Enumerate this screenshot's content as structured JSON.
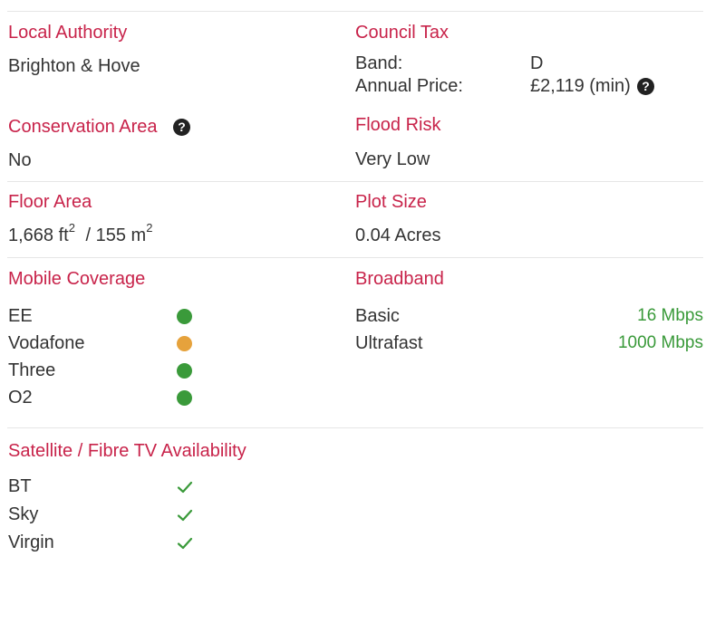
{
  "local_authority": {
    "heading": "Local Authority",
    "value": "Brighton & Hove"
  },
  "council_tax": {
    "heading": "Council Tax",
    "band_label": "Band:",
    "band_value": "D",
    "price_label": "Annual Price:",
    "price_value": "£2,119 (min)"
  },
  "conservation_area": {
    "heading": "Conservation Area",
    "value": "No"
  },
  "flood_risk": {
    "heading": "Flood Risk",
    "value": "Very Low"
  },
  "floor_area": {
    "heading": "Floor Area",
    "sqft": "1,668 ft",
    "sqm": " / 155 m",
    "power": "2"
  },
  "plot_size": {
    "heading": "Plot Size",
    "value": "0.04 Acres"
  },
  "mobile_coverage": {
    "heading": "Mobile Coverage",
    "networks": [
      {
        "name": "EE",
        "status": "good",
        "color": "#3a9a3a"
      },
      {
        "name": "Vodafone",
        "status": "partial",
        "color": "#e6a23c"
      },
      {
        "name": "Three",
        "status": "good",
        "color": "#3a9a3a"
      },
      {
        "name": "O2",
        "status": "good",
        "color": "#3a9a3a"
      }
    ]
  },
  "broadband": {
    "heading": "Broadband",
    "items": [
      {
        "type": "Basic",
        "speed": "16 Mbps"
      },
      {
        "type": "Ultrafast",
        "speed": "1000 Mbps"
      }
    ]
  },
  "tv_availability": {
    "heading": "Satellite / Fibre TV Availability",
    "providers": [
      {
        "name": "BT",
        "available": true,
        "icon": "check-icon"
      },
      {
        "name": "Sky",
        "available": true,
        "icon": "check-icon"
      },
      {
        "name": "Virgin",
        "available": true,
        "icon": "check-icon"
      }
    ]
  },
  "colors": {
    "heading": "#c8234a",
    "text": "#333333",
    "good": "#3a9a3a",
    "partial": "#e6a23c",
    "divider": "#e6e6e6"
  },
  "icons": {
    "help": "question-circle-icon",
    "available": "check-icon",
    "coverage": "status-dot"
  },
  "help_glyph": "?"
}
